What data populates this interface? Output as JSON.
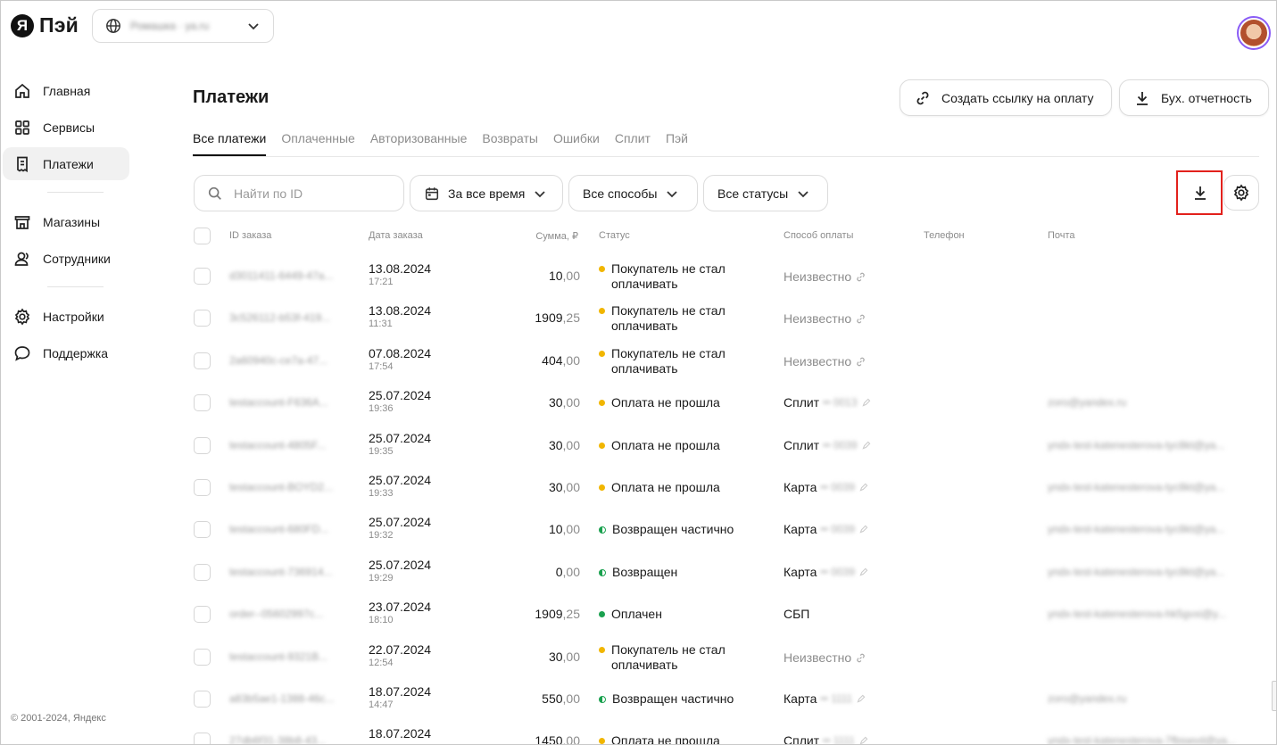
{
  "header": {
    "logo_mark": "Я",
    "logo_text": "Пэй",
    "org_name": "Ромашка · ya.ru"
  },
  "sidebar": {
    "items": [
      {
        "label": "Главная",
        "icon": "home-icon"
      },
      {
        "label": "Сервисы",
        "icon": "grid-icon"
      },
      {
        "label": "Платежи",
        "icon": "receipt-icon",
        "active": true
      },
      {
        "label": "Магазины",
        "icon": "store-icon"
      },
      {
        "label": "Сотрудники",
        "icon": "users-icon"
      },
      {
        "label": "Настройки",
        "icon": "gear-icon"
      },
      {
        "label": "Поддержка",
        "icon": "chat-icon"
      }
    ],
    "footer": "© 2001-2024, Яндекс"
  },
  "main": {
    "title": "Платежи",
    "create_link_label": "Создать ссылку на оплату",
    "report_label": "Бух. отчетность",
    "tabs": [
      "Все платежи",
      "Оплаченные",
      "Авторизованные",
      "Возвраты",
      "Ошибки",
      "Сплит",
      "Пэй"
    ],
    "search_placeholder": "Найти по ID",
    "filter_period": "За все время",
    "filter_methods": "Все способы",
    "filter_statuses": "Все статусы"
  },
  "table": {
    "columns": {
      "id": "ID заказа",
      "date": "Дата заказа",
      "sum": "Сумма, ₽",
      "status": "Статус",
      "method": "Способ оплаты",
      "phone": "Телефон",
      "email": "Почта"
    },
    "rows": [
      {
        "id": "d3011411-6449-47a...",
        "date": "13.08.2024",
        "time": "17:21",
        "sum_int": "10",
        "sum_frac": ",00",
        "status": "Покупатель не стал оплачивать",
        "status_color": "yellow",
        "method": "Неизвестно",
        "mask": "",
        "email": ""
      },
      {
        "id": "3c526112-b53f-419...",
        "date": "13.08.2024",
        "time": "11:31",
        "sum_int": "1909",
        "sum_frac": ",25",
        "status": "Покупатель не стал оплачивать",
        "status_color": "yellow",
        "method": "Неизвестно",
        "mask": "",
        "email": ""
      },
      {
        "id": "2a60940c-ce7a-47...",
        "date": "07.08.2024",
        "time": "17:54",
        "sum_int": "404",
        "sum_frac": ",00",
        "status": "Покупатель не стал оплачивать",
        "status_color": "yellow",
        "method": "Неизвестно",
        "mask": "",
        "email": ""
      },
      {
        "id": "testaccount-F636A...",
        "date": "25.07.2024",
        "time": "19:36",
        "sum_int": "30",
        "sum_frac": ",00",
        "status": "Оплата не прошла",
        "status_color": "yellow",
        "method": "Сплит",
        "mask": "•• 0013",
        "email": "zoro@yandex.ru"
      },
      {
        "id": "testaccount-4805F...",
        "date": "25.07.2024",
        "time": "19:35",
        "sum_int": "30",
        "sum_frac": ",00",
        "status": "Оплата не прошла",
        "status_color": "yellow",
        "method": "Сплит",
        "mask": "•• 0039",
        "email": "yndx-test-katenesterova-tyc8kt@ya..."
      },
      {
        "id": "testaccount-BOYD2...",
        "date": "25.07.2024",
        "time": "19:33",
        "sum_int": "30",
        "sum_frac": ",00",
        "status": "Оплата не прошла",
        "status_color": "yellow",
        "method": "Карта",
        "mask": "•• 0039",
        "email": "yndx-test-katenesterova-tyc8kt@ya..."
      },
      {
        "id": "testaccount-680FD...",
        "date": "25.07.2024",
        "time": "19:32",
        "sum_int": "10",
        "sum_frac": ",00",
        "status": "Возвращен частично",
        "status_color": "half",
        "method": "Карта",
        "mask": "•• 0039",
        "email": "yndx-test-katenesterova-tyc8kt@ya..."
      },
      {
        "id": "testaccount-736914...",
        "date": "25.07.2024",
        "time": "19:29",
        "sum_int": "0",
        "sum_frac": ",00",
        "status": "Возвращен",
        "status_color": "half",
        "method": "Карта",
        "mask": "•• 0039",
        "email": "yndx-test-katenesterova-tyc8kt@ya..."
      },
      {
        "id": "order--05602997c...",
        "date": "23.07.2024",
        "time": "18:10",
        "sum_int": "1909",
        "sum_frac": ",25",
        "status": "Оплачен",
        "status_color": "green",
        "method": "СБП",
        "mask": "",
        "email": "yndx-test-katenesterova-hk5gvxi@y..."
      },
      {
        "id": "testaccount-9321B...",
        "date": "22.07.2024",
        "time": "12:54",
        "sum_int": "30",
        "sum_frac": ",00",
        "status": "Покупатель не стал оплачивать",
        "status_color": "yellow",
        "method": "Неизвестно",
        "mask": "",
        "email": ""
      },
      {
        "id": "a83b5ae1-1388-46c...",
        "date": "18.07.2024",
        "time": "14:47",
        "sum_int": "550",
        "sum_frac": ",00",
        "status": "Возвращен частично",
        "status_color": "half",
        "method": "Карта",
        "mask": "•• 1111",
        "email": "zoro@yandex.ru"
      },
      {
        "id": "27db6f31-38b8-43...",
        "date": "18.07.2024",
        "time": "",
        "sum_int": "1450",
        "sum_frac": ",00",
        "status": "Оплата не прошла",
        "status_color": "yellow",
        "method": "Сплит",
        "mask": "•• 1111",
        "email": "yndx-test-katenesterova-7fbswvd@ya..."
      }
    ]
  }
}
